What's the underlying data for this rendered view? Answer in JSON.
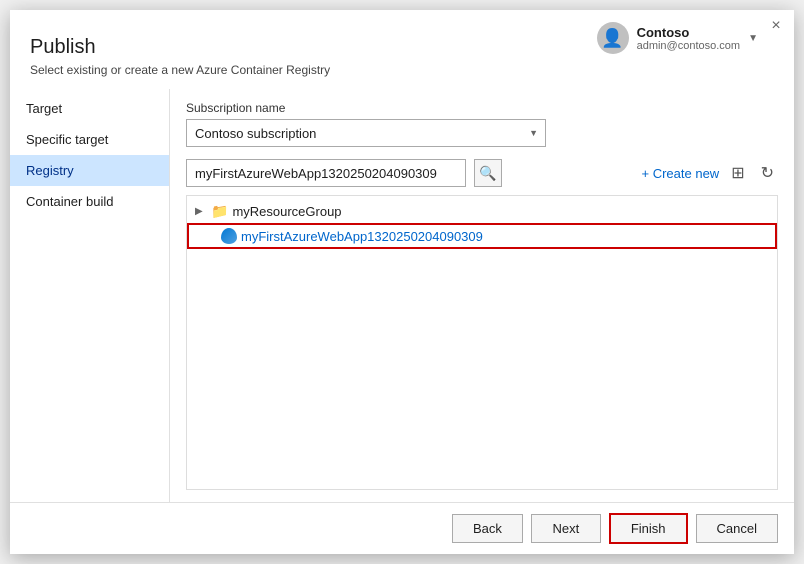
{
  "dialog": {
    "title": "Publish",
    "subtitle": "Select existing or create a new Azure Container Registry",
    "close_label": "×"
  },
  "user": {
    "name": "Contoso",
    "email": "admin@contoso.com"
  },
  "sidebar": {
    "items": [
      {
        "id": "target",
        "label": "Target"
      },
      {
        "id": "specific-target",
        "label": "Specific target"
      },
      {
        "id": "registry",
        "label": "Registry",
        "active": true
      },
      {
        "id": "container-build",
        "label": "Container build"
      }
    ]
  },
  "main": {
    "subscription_label": "Subscription name",
    "subscription_value": "Contoso subscription",
    "registry_search_value": "myFirstAzureWebApp1320250204090309",
    "create_new_label": "+ Create new",
    "tree": {
      "group": "myResourceGroup",
      "child": "myFirstAzureWebApp1320250204090309"
    }
  },
  "footer": {
    "back_label": "Back",
    "next_label": "Next",
    "finish_label": "Finish",
    "cancel_label": "Cancel"
  }
}
